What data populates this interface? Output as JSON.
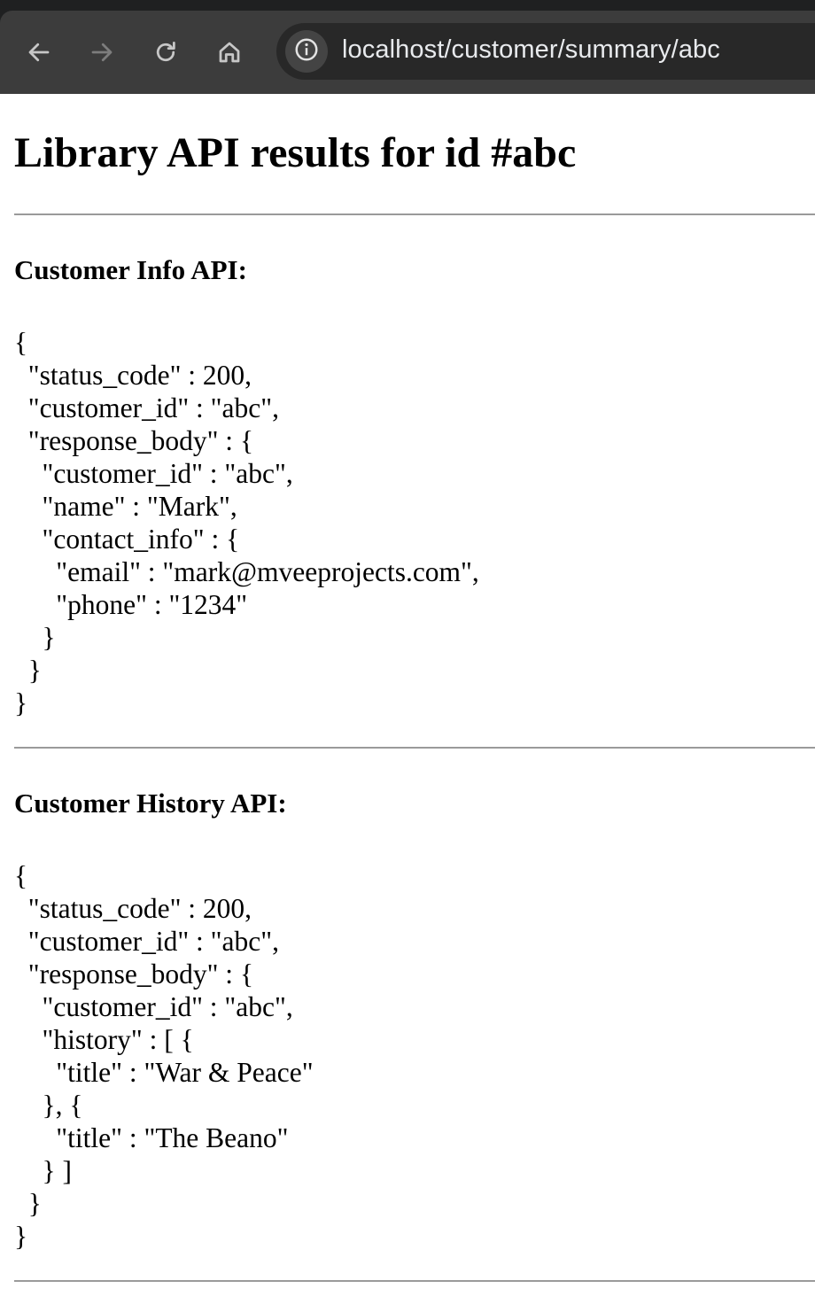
{
  "browser": {
    "url": "localhost/customer/summary/abc",
    "back_icon": "arrow-left-icon",
    "forward_icon": "arrow-right-icon",
    "reload_icon": "reload-icon",
    "home_icon": "home-icon",
    "site_info_icon": "info-circle-icon",
    "colors": {
      "chrome_background": "#1f2021",
      "toolbar_background": "#3c3c3c",
      "omnibox_background": "#282828",
      "url_text": "#e8eaed"
    }
  },
  "page": {
    "title": "Library API results for id #abc",
    "sections": [
      {
        "title": "Customer Info API:",
        "json": "{\n  \"status_code\" : 200,\n  \"customer_id\" : \"abc\",\n  \"response_body\" : {\n    \"customer_id\" : \"abc\",\n    \"name\" : \"Mark\",\n    \"contact_info\" : {\n      \"email\" : \"mark@mveeprojects.com\",\n      \"phone\" : \"1234\"\n    }\n  }\n}"
      },
      {
        "title": "Customer History API:",
        "json": "{\n  \"status_code\" : 200,\n  \"customer_id\" : \"abc\",\n  \"response_body\" : {\n    \"customer_id\" : \"abc\",\n    \"history\" : [ {\n      \"title\" : \"War & Peace\"\n    }, {\n      \"title\" : \"The Beano\"\n    } ]\n  }\n}"
      }
    ]
  }
}
